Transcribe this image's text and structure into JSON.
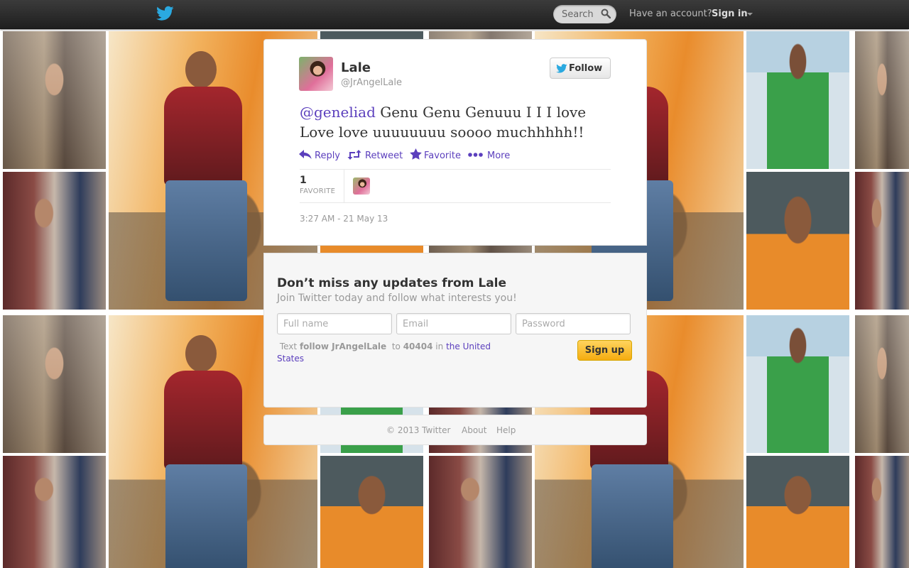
{
  "topbar": {
    "search_placeholder": "Search",
    "have_account": "Have an account?",
    "sign_in": "Sign in"
  },
  "tweet": {
    "author_name": "Lale",
    "author_handle": "@JrAngelLale",
    "follow_label": "Follow",
    "mention": "@geneliad",
    "text": " Genu Genu Genuuu I I I love Love love uuuuuuuu soooo muchhhhh!!",
    "actions": {
      "reply": "Reply",
      "retweet": "Retweet",
      "favorite": "Favorite",
      "more": "More"
    },
    "favorite_count": "1",
    "favorite_label": "FAVORITE",
    "timestamp": "3:27 AM - 21 May 13"
  },
  "signup": {
    "title": "Don’t miss any updates from Lale",
    "subtitle": "Join Twitter today and follow what interests you!",
    "fullname_placeholder": "Full name",
    "email_placeholder": "Email",
    "password_placeholder": "Password",
    "sms_text_prefix": "Text",
    "sms_command": "follow JrAngelLale",
    "sms_to": "to",
    "sms_number": "40404",
    "sms_in": "in",
    "sms_country": "the United States",
    "signup_label": "Sign up"
  },
  "footer": {
    "copyright": "© 2013 Twitter",
    "about": "About",
    "help": "Help"
  },
  "colors": {
    "link": "#5b3fbd",
    "twitter_blue": "#2aa9e0",
    "signup_yellow": "#f5ac10"
  }
}
